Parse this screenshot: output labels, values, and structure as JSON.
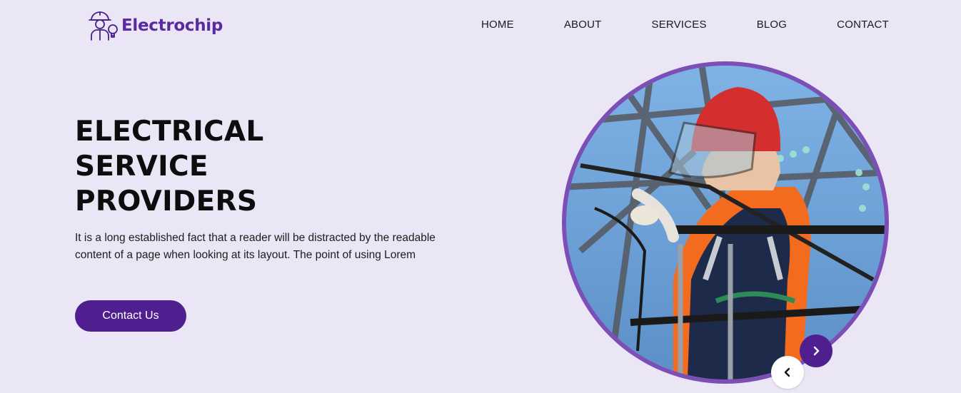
{
  "brand": {
    "name": "Electrochip",
    "icon": "electrician-worker-icon",
    "color": "#5a2aa0"
  },
  "nav": {
    "items": [
      {
        "label": "HOME"
      },
      {
        "label": "ABOUT"
      },
      {
        "label": "SERVICES"
      },
      {
        "label": "BLOG"
      },
      {
        "label": "CONTACT"
      }
    ]
  },
  "hero": {
    "title_lines": [
      "ELECTRICAL",
      "SERVICE",
      "PROVIDERS"
    ],
    "text": "It is a long established fact that a reader will be distracted by the readable content of a page when looking at its layout. The point of using Lorem",
    "cta_label": "Contact Us"
  },
  "slider": {
    "image": "electrician-lineman-on-pylon-photo",
    "prev_icon": "chevron-left-icon",
    "next_icon": "chevron-right-icon"
  },
  "colors": {
    "accent": "#4f1f8f",
    "ring": "#7b4fb5",
    "background": "#ebe6f5"
  }
}
